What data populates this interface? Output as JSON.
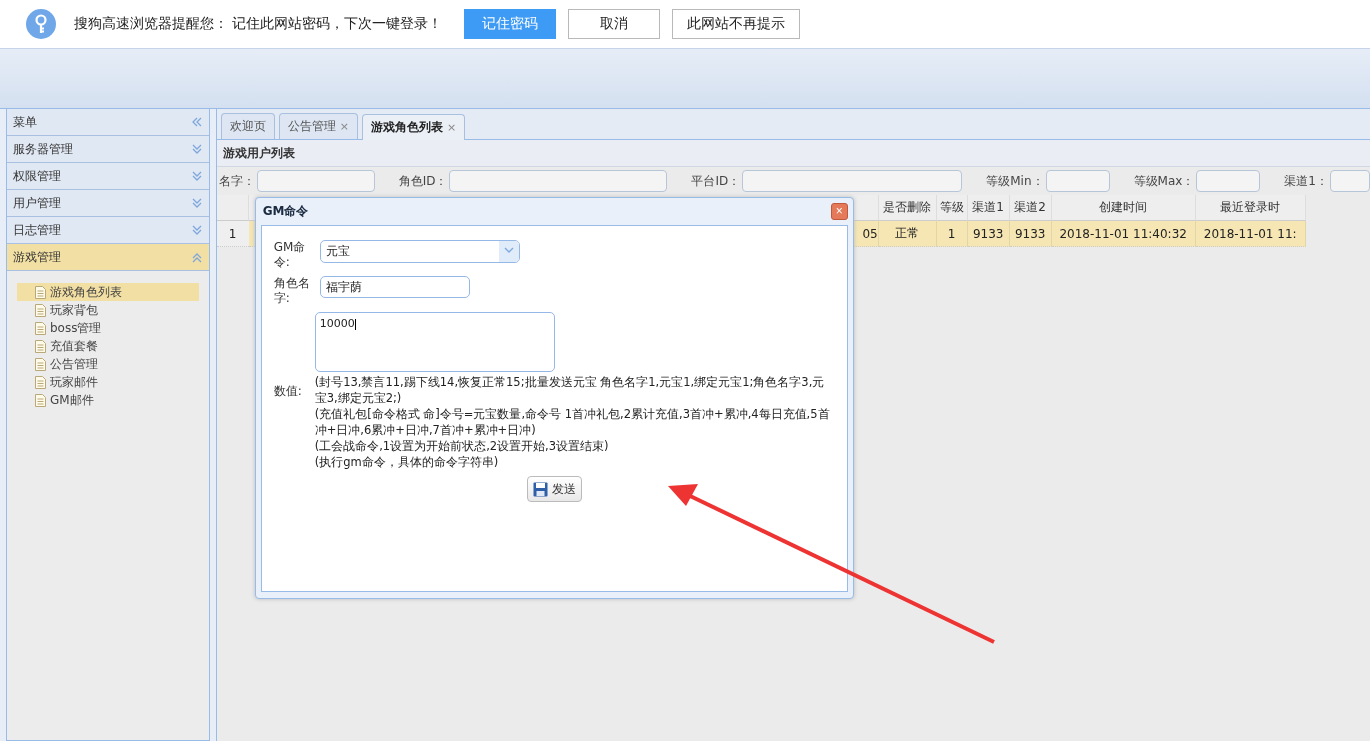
{
  "notice": {
    "text": "搜狗高速浏览器提醒您： 记住此网站密码，下次一键登录！",
    "buttons": [
      {
        "label": "记住密码",
        "primary": true
      },
      {
        "label": "取消",
        "primary": false
      },
      {
        "label": "此网站不再提示",
        "primary": false
      }
    ]
  },
  "sidebar": {
    "title": "菜单",
    "sections": [
      {
        "label": "服务器管理",
        "expanded": false
      },
      {
        "label": "权限管理",
        "expanded": false
      },
      {
        "label": "用户管理",
        "expanded": false
      },
      {
        "label": "日志管理",
        "expanded": false
      },
      {
        "label": "游戏管理",
        "expanded": true,
        "children": [
          {
            "label": "游戏角色列表",
            "selected": true
          },
          {
            "label": "玩家背包",
            "selected": false
          },
          {
            "label": "boss管理",
            "selected": false
          },
          {
            "label": "充值套餐",
            "selected": false
          },
          {
            "label": "公告管理",
            "selected": false
          },
          {
            "label": "玩家邮件",
            "selected": false
          },
          {
            "label": "GM邮件",
            "selected": false
          }
        ]
      }
    ]
  },
  "tabs": [
    {
      "label": "欢迎页",
      "selected": false,
      "closable": false
    },
    {
      "label": "公告管理",
      "selected": false,
      "closable": true
    },
    {
      "label": "游戏角色列表",
      "selected": true,
      "closable": true
    }
  ],
  "close_mark": "×",
  "panel": {
    "title": "游戏用户列表",
    "filters": [
      "名字：",
      "角色ID：",
      "平台ID：",
      "等级Min：",
      "等级Max：",
      "渠道1："
    ],
    "table": {
      "columns": [
        "是否删除",
        "等级",
        "渠道1",
        "渠道2",
        "创建时间",
        "最近登录时"
      ],
      "rows": [
        {
          "index": "1",
          "hidden_tail": "05",
          "cells": [
            "正常",
            "1",
            "9133",
            "9133",
            "2018-11-01 11:40:32",
            "2018-11-01 11:"
          ],
          "selected": true
        }
      ]
    }
  },
  "dialog": {
    "title": "GM命令",
    "fields": [
      {
        "kind": "select",
        "label": "GM命令:",
        "value": "元宝"
      },
      {
        "kind": "text",
        "label": "角色名字:",
        "value": "福宇荫"
      },
      {
        "kind": "textarea",
        "label": "数值:",
        "value": "10000",
        "help": [
          "(封号13,禁言11,踢下线14,恢复正常15;批量发送元宝 角色名字1,元宝1,绑定元宝1;角色名字3,元宝3,绑定元宝2;)",
          "(充值礼包[命令格式 命]令号=元宝数量,命令号 1首冲礼包,2累计充值,3首冲+累冲,4每日充值,5首冲+日冲,6累冲+日冲,7首冲+累冲+日冲)",
          "(工会战命令,1设置为开始前状态,2设置开始,3设置结束)",
          "(执行gm命令，具体的命令字符串)"
        ]
      }
    ],
    "button": "发送"
  }
}
